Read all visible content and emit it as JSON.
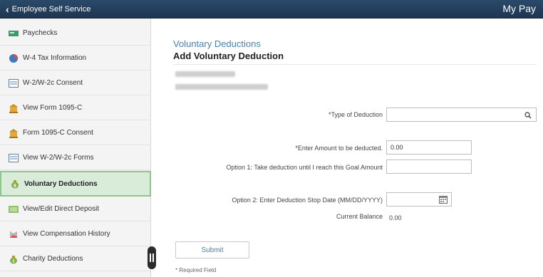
{
  "topbar": {
    "back_label": "Employee Self Service",
    "page_title": "My Pay"
  },
  "sidebar": {
    "items": [
      {
        "label": "Paychecks",
        "icon": "paycheck-icon"
      },
      {
        "label": "W-4 Tax Information",
        "icon": "pie-chart-icon"
      },
      {
        "label": "W-2/W-2c Consent",
        "icon": "document-icon"
      },
      {
        "label": "View Form 1095-C",
        "icon": "building-icon"
      },
      {
        "label": "Form 1095-C Consent",
        "icon": "building-icon"
      },
      {
        "label": "View W-2/W-2c Forms",
        "icon": "document-icon"
      },
      {
        "label": "Voluntary Deductions",
        "icon": "money-bag-icon",
        "active": true
      },
      {
        "label": "View/Edit Direct Deposit",
        "icon": "bank-icon"
      },
      {
        "label": "View Compensation History",
        "icon": "chart-icon"
      },
      {
        "label": "Charity Deductions",
        "icon": "money-bag-icon"
      }
    ]
  },
  "main": {
    "section_title": "Voluntary Deductions",
    "form_title": "Add Voluntary Deduction",
    "type_label": "*Type of Deduction",
    "type_value": "",
    "amount_label": "*Enter Amount to be deducted.",
    "amount_value": "0.00",
    "goal_label": "Option 1: Take deduction until I reach this Goal Amount",
    "goal_value": "",
    "stop_date_label": "Option 2: Enter Deduction Stop Date (MM/DD/YYYY)",
    "stop_date_value": "",
    "balance_label": "Current Balance",
    "balance_value": "0.00",
    "submit_label": "Submit",
    "required_note": "* Required Field"
  },
  "colors": {
    "topbar": "#1d3550",
    "accent": "#4a7fae",
    "active_item_bg": "#d9ecd9",
    "active_item_border": "#8cc68c"
  }
}
